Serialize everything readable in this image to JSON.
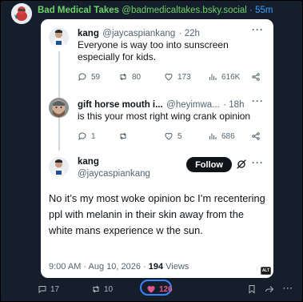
{
  "outer_post": {
    "author_name": "Bad Medical Takes",
    "author_handle": "@badmedicaltakes.bsky.social",
    "separator": "·",
    "time": "55m"
  },
  "tweets": [
    {
      "name": "kang",
      "handle": "@jaycaspiankang",
      "time": "· 22h",
      "text": "Everyone is way too into sunscreen especially for kids.",
      "metrics": {
        "replies": "59",
        "reposts": "80",
        "likes": "173",
        "views": "616K"
      }
    },
    {
      "name": "gift horse mouth i...",
      "handle": "@heyimwa...",
      "time": "· 18h",
      "text": "is this your most right wing crank opinion",
      "metrics": {
        "replies": "1",
        "reposts": "",
        "likes": "5",
        "views": "686"
      }
    }
  ],
  "main_tweet": {
    "name": "kang",
    "handle": "@jaycaspiankang",
    "follow_label": "Follow",
    "text": "No it’s my most woke opinion bc I’m recentering ppl with melanin in their skin away from the white mans experience w the sun.",
    "time": "9:00 AM · Aug 10, 2026 · ",
    "views_count": "194",
    "views_label": " Views"
  },
  "alt_badge": "ALT",
  "more_glyph": "···",
  "actions": {
    "replies": "17",
    "reposts": "10",
    "likes": "126"
  },
  "colors": {
    "accent_green": "#6fd36b",
    "link_blue": "#3aa0ff",
    "like_pink": "#e0598b",
    "focus_ring": "#3b82f6"
  }
}
